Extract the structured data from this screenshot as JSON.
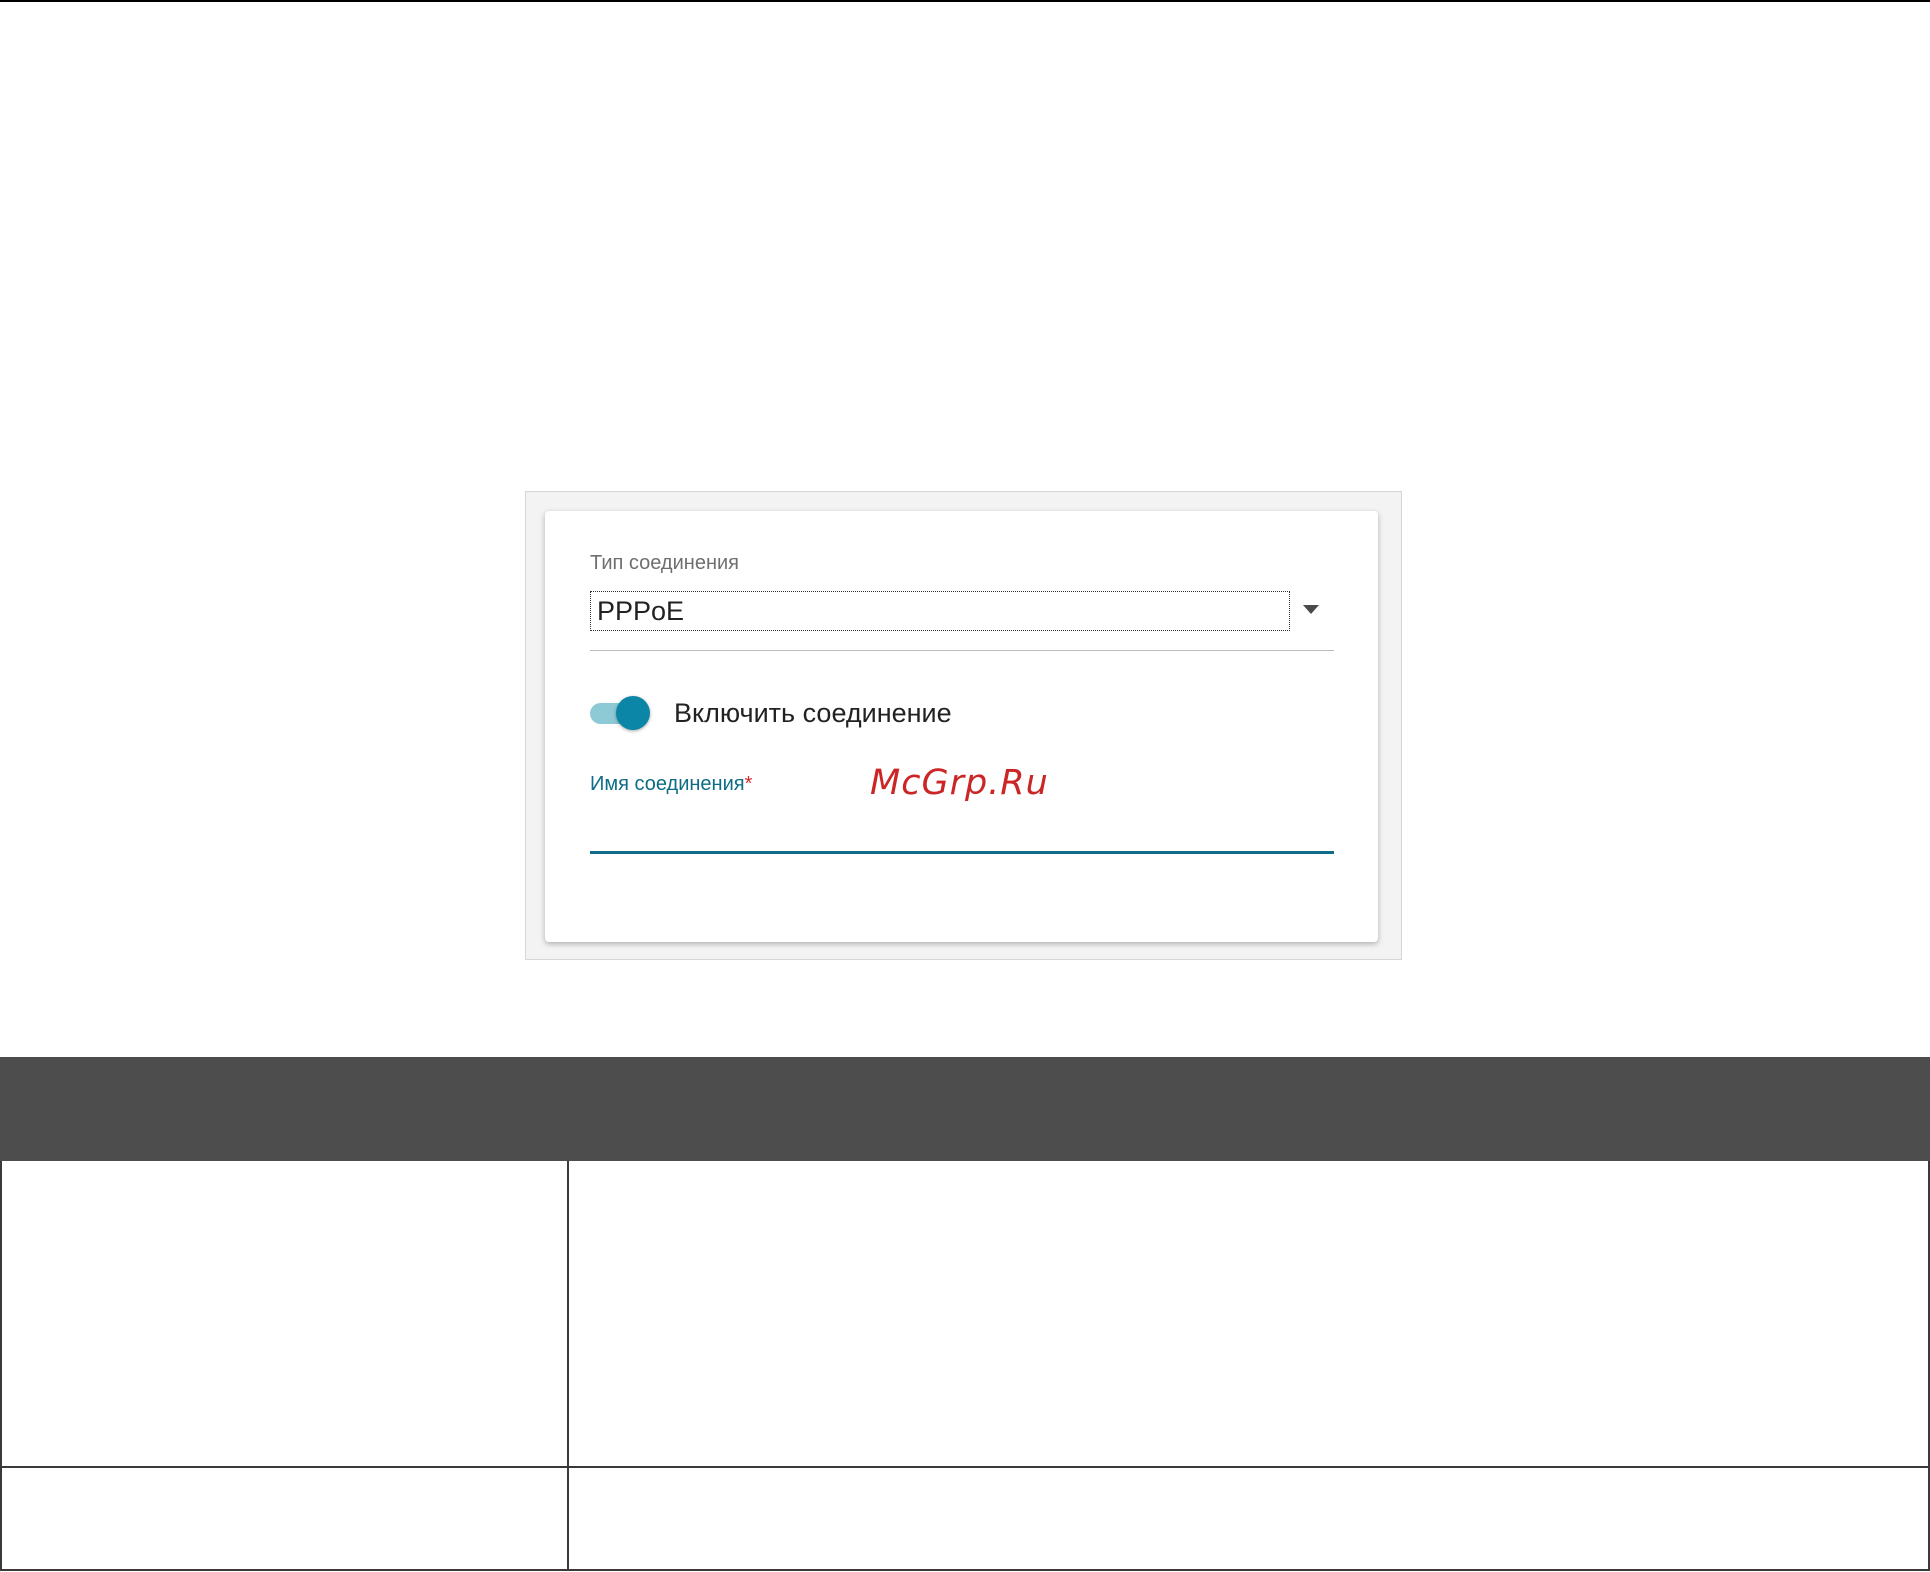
{
  "connection_form": {
    "type_label": "Тип соединения",
    "type_value": "PPPoE",
    "enable_label": "Включить соединение",
    "enable_state": true,
    "name_label": "Имя соединения",
    "required_mark": "*",
    "name_value": ""
  },
  "watermark": {
    "text": "McGrp.Ru"
  },
  "colors": {
    "accent": "#0e6c86",
    "toggle_thumb": "#0c86a6",
    "toggle_track": "#8ec9d6",
    "required": "#d52b2b",
    "watermark": "#cc2525",
    "table_header": "#4d4d4d"
  },
  "icons": {
    "select_arrow": "chevron-down-icon"
  }
}
